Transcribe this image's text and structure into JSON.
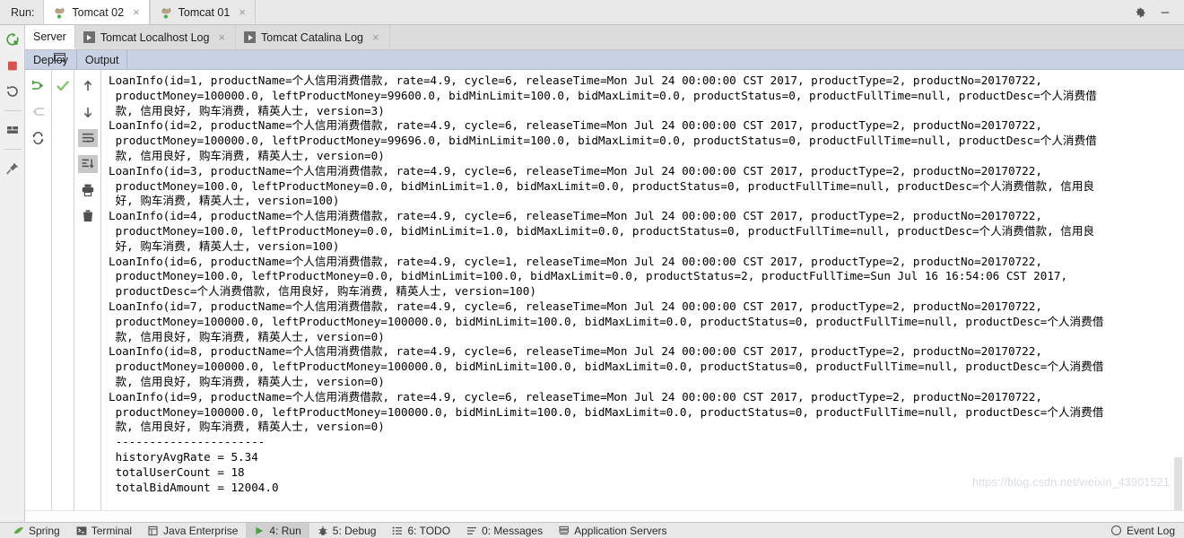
{
  "runbar": {
    "label": "Run:",
    "tabs": [
      {
        "title": "Tomcat 02",
        "icon": "tomcat-icon",
        "close": "×",
        "active": true
      },
      {
        "title": "Tomcat 01",
        "icon": "tomcat-icon",
        "close": "×",
        "active": false
      }
    ],
    "window_controls": [
      {
        "name": "settings-gear-icon",
        "glyph": "gear"
      },
      {
        "name": "minimize-icon",
        "glyph": "minus"
      }
    ]
  },
  "side_toolbar": {
    "items": [
      {
        "name": "rerun-icon",
        "title": "Rerun"
      },
      {
        "name": "stop-icon",
        "title": "Stop"
      },
      {
        "name": "restart-icon",
        "title": "Restart"
      },
      {
        "name": "separator-1",
        "title": ""
      },
      {
        "name": "layout-icon",
        "title": "Layout"
      },
      {
        "name": "separator-2",
        "title": ""
      },
      {
        "name": "pin-icon",
        "title": "Pin Tab"
      }
    ]
  },
  "log_tabs": [
    {
      "label": "Server",
      "icon": null,
      "closable": false,
      "active": true
    },
    {
      "label": "Tomcat Localhost Log",
      "icon": "play-icon",
      "closable": true,
      "active": false
    },
    {
      "label": "Tomcat Catalina Log",
      "icon": "play-icon",
      "closable": true,
      "active": false
    }
  ],
  "sub_tabs": [
    {
      "label": "Deploy",
      "selected": false
    },
    {
      "label": "Output",
      "selected": true
    }
  ],
  "console_toolbar": {
    "column_a": [
      {
        "name": "scroll-to-stacktrace-icon",
        "state": "enabled"
      },
      {
        "name": "back-arrow-icon",
        "state": "disabled"
      },
      {
        "name": "rerun-tests-icon",
        "state": "enabled"
      }
    ],
    "column_b": [
      {
        "name": "checkmark-icon",
        "state": "enabled"
      }
    ],
    "column_c": [
      {
        "name": "arrow-up-icon",
        "state": "enabled",
        "toggled": false
      },
      {
        "name": "arrow-down-icon",
        "state": "enabled",
        "toggled": false
      },
      {
        "name": "soft-wrap-icon",
        "state": "enabled",
        "toggled": true
      },
      {
        "name": "scroll-to-end-icon",
        "state": "enabled",
        "toggled": true
      },
      {
        "name": "print-icon",
        "state": "enabled",
        "toggled": false
      },
      {
        "name": "clear-all-icon",
        "state": "enabled",
        "toggled": false
      }
    ]
  },
  "console": {
    "lines": [
      "LoanInfo(id=1, productName=个人信用消费借款, rate=4.9, cycle=6, releaseTime=Mon Jul 24 00:00:00 CST 2017, productType=2, productNo=20170722,",
      " productMoney=100000.0, leftProductMoney=99600.0, bidMinLimit=100.0, bidMaxLimit=0.0, productStatus=0, productFullTime=null, productDesc=个人消费借",
      " 款, 信用良好, 购车消费, 精英人士, version=3)",
      "LoanInfo(id=2, productName=个人信用消费借款, rate=4.9, cycle=6, releaseTime=Mon Jul 24 00:00:00 CST 2017, productType=2, productNo=20170722,",
      " productMoney=100000.0, leftProductMoney=99696.0, bidMinLimit=100.0, bidMaxLimit=0.0, productStatus=0, productFullTime=null, productDesc=个人消费借",
      " 款, 信用良好, 购车消费, 精英人士, version=0)",
      "LoanInfo(id=3, productName=个人信用消费借款, rate=4.9, cycle=6, releaseTime=Mon Jul 24 00:00:00 CST 2017, productType=2, productNo=20170722,",
      " productMoney=100.0, leftProductMoney=0.0, bidMinLimit=1.0, bidMaxLimit=0.0, productStatus=0, productFullTime=null, productDesc=个人消费借款, 信用良",
      " 好, 购车消费, 精英人士, version=100)",
      "LoanInfo(id=4, productName=个人信用消费借款, rate=4.9, cycle=6, releaseTime=Mon Jul 24 00:00:00 CST 2017, productType=2, productNo=20170722,",
      " productMoney=100.0, leftProductMoney=0.0, bidMinLimit=1.0, bidMaxLimit=0.0, productStatus=0, productFullTime=null, productDesc=个人消费借款, 信用良",
      " 好, 购车消费, 精英人士, version=100)",
      "LoanInfo(id=6, productName=个人信用消费借款, rate=4.9, cycle=1, releaseTime=Mon Jul 24 00:00:00 CST 2017, productType=2, productNo=20170722,",
      " productMoney=100.0, leftProductMoney=0.0, bidMinLimit=100.0, bidMaxLimit=0.0, productStatus=2, productFullTime=Sun Jul 16 16:54:06 CST 2017,",
      " productDesc=个人消费借款, 信用良好, 购车消费, 精英人士, version=100)",
      "LoanInfo(id=7, productName=个人信用消费借款, rate=4.9, cycle=6, releaseTime=Mon Jul 24 00:00:00 CST 2017, productType=2, productNo=20170722,",
      " productMoney=100000.0, leftProductMoney=100000.0, bidMinLimit=100.0, bidMaxLimit=0.0, productStatus=0, productFullTime=null, productDesc=个人消费借",
      " 款, 信用良好, 购车消费, 精英人士, version=0)",
      "LoanInfo(id=8, productName=个人信用消费借款, rate=4.9, cycle=6, releaseTime=Mon Jul 24 00:00:00 CST 2017, productType=2, productNo=20170722,",
      " productMoney=100000.0, leftProductMoney=100000.0, bidMinLimit=100.0, bidMaxLimit=0.0, productStatus=0, productFullTime=null, productDesc=个人消费借",
      " 款, 信用良好, 购车消费, 精英人士, version=0)",
      "LoanInfo(id=9, productName=个人信用消费借款, rate=4.9, cycle=6, releaseTime=Mon Jul 24 00:00:00 CST 2017, productType=2, productNo=20170722,",
      " productMoney=100000.0, leftProductMoney=100000.0, bidMinLimit=100.0, bidMaxLimit=0.0, productStatus=0, productFullTime=null, productDesc=个人消费借",
      " 款, 信用良好, 购车消费, 精英人士, version=0)",
      " ----------------------",
      " historyAvgRate = 5.34",
      " totalUserCount = 18",
      " totalBidAmount = 12004.0"
    ]
  },
  "watermark": "https://blog.csdn.net/weixin_43901521",
  "statusbar": {
    "items": [
      {
        "label": "Spring",
        "icon": "spring-leaf-icon",
        "active": false
      },
      {
        "label": "Terminal",
        "icon": "terminal-icon",
        "active": false
      },
      {
        "label": "Java Enterprise",
        "icon": "java-enterprise-icon",
        "active": false
      },
      {
        "label": "4: Run",
        "icon": "run-play-icon",
        "active": true
      },
      {
        "label": "5: Debug",
        "icon": "debug-bug-icon",
        "active": false
      },
      {
        "label": "6: TODO",
        "icon": "todo-list-icon",
        "active": false
      },
      {
        "label": "0: Messages",
        "icon": "messages-icon",
        "active": false
      },
      {
        "label": "Application Servers",
        "icon": "app-servers-icon",
        "active": false
      }
    ],
    "right": {
      "label": "Event Log",
      "icon": "event-log-icon"
    }
  },
  "colors": {
    "accent_green": "#4a9e3f",
    "stop_red": "#d9534f",
    "tab_bar": "#e8e8e8",
    "subtab_blue": "#c9d2e4",
    "selection": "#c8c8c8"
  }
}
